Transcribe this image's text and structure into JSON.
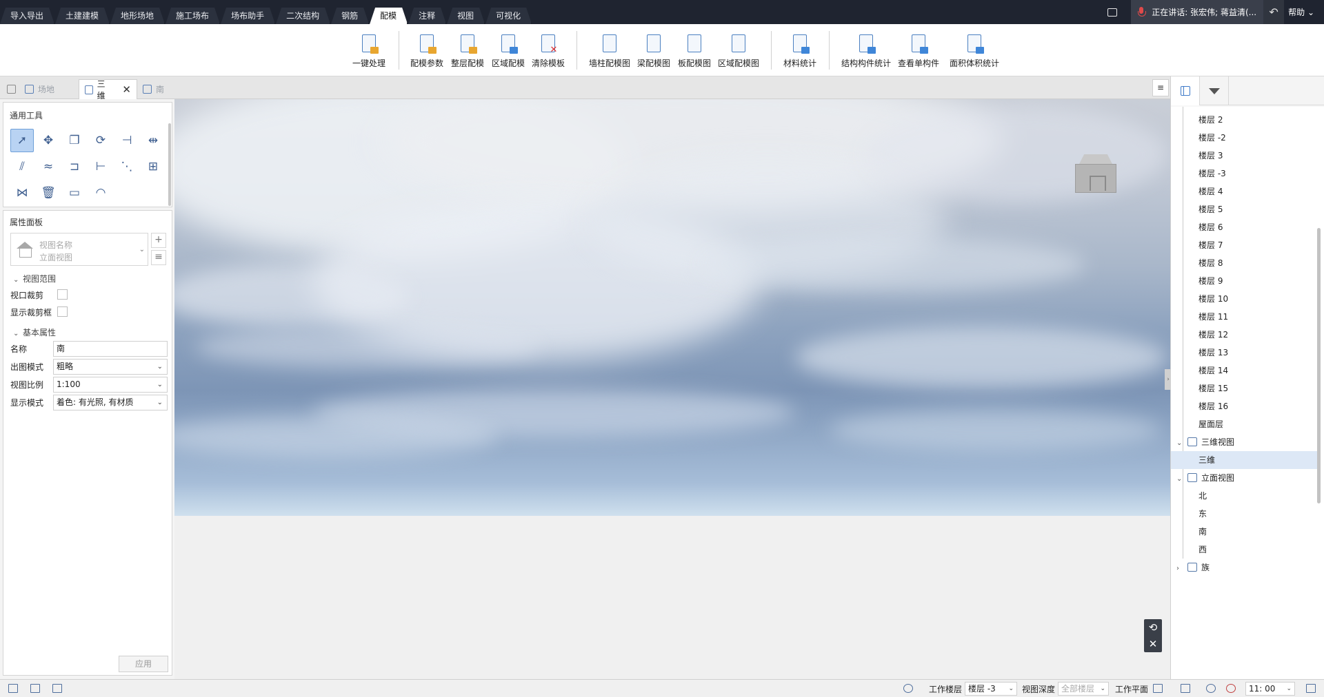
{
  "menu": {
    "tabs": [
      "导入导出",
      "土建建模",
      "地形场地",
      "施工场布",
      "场布助手",
      "二次结构",
      "钢筋",
      "配模",
      "注释",
      "视图",
      "可视化"
    ],
    "active_tab": "配模",
    "speaking": "正在讲话: 张宏伟; 蒋益清(...",
    "help": "帮助"
  },
  "ribbon": {
    "items": [
      "一键处理",
      "配模参数",
      "整层配模",
      "区域配模",
      "清除模板",
      "墙柱配模图",
      "梁配模图",
      "板配模图",
      "区域配模图",
      "材料统计",
      "结构构件统计",
      "查看单构件",
      "面积体积统计"
    ]
  },
  "view_tabs": {
    "tabs": [
      "场地",
      "三维",
      "南"
    ],
    "active": "三维"
  },
  "left_panel": {
    "tools_title": "通用工具",
    "tool_icons": [
      "select-icon",
      "move-icon",
      "copy-icon",
      "rotate-icon",
      "align-icon",
      "split-icon",
      "offset-icon",
      "stretch-icon",
      "trim-icon",
      "extend-icon",
      "break-icon",
      "array-icon",
      "mirror-icon",
      "delete-icon",
      "measure-icon",
      "angle-icon"
    ],
    "props_title": "属性面板",
    "view_name_label": "视图名称",
    "view_type": "立面视图",
    "group_range": "视图范围",
    "crop_label": "视口裁剪",
    "show_crop_label": "显示裁剪框",
    "group_basic": "基本属性",
    "name_label": "名称",
    "name_value": "南",
    "output_mode_label": "出图模式",
    "output_mode_value": "粗略",
    "scale_label": "视图比例",
    "scale_value": "1:100",
    "display_mode_label": "显示模式",
    "display_mode_value": "着色: 有光照, 有材质",
    "apply": "应用"
  },
  "tree": {
    "floors": [
      "楼层 2",
      "楼层 -2",
      "楼层 3",
      "楼层 -3",
      "楼层 4",
      "楼层 5",
      "楼层 6",
      "楼层 7",
      "楼层 8",
      "楼层 9",
      "楼层 10",
      "楼层 11",
      "楼层 12",
      "楼层 13",
      "楼层 14",
      "楼层 15",
      "楼层 16",
      "屋面层"
    ],
    "group_3d": "三维视图",
    "item_3d": "三维",
    "group_elev": "立面视图",
    "elevations": [
      "北",
      "东",
      "南",
      "西"
    ],
    "group_family": "族"
  },
  "status": {
    "work_floor_label": "工作楼层",
    "work_floor_value": "楼层 -3",
    "view_depth_label": "视图深度",
    "view_depth_value": "全部楼层",
    "work_plane_label": "工作平面",
    "time_value": "11: 00"
  },
  "colors": {
    "menubar": "#1f2430",
    "accent": "#3d79c8",
    "selection": "#dde8f6"
  }
}
